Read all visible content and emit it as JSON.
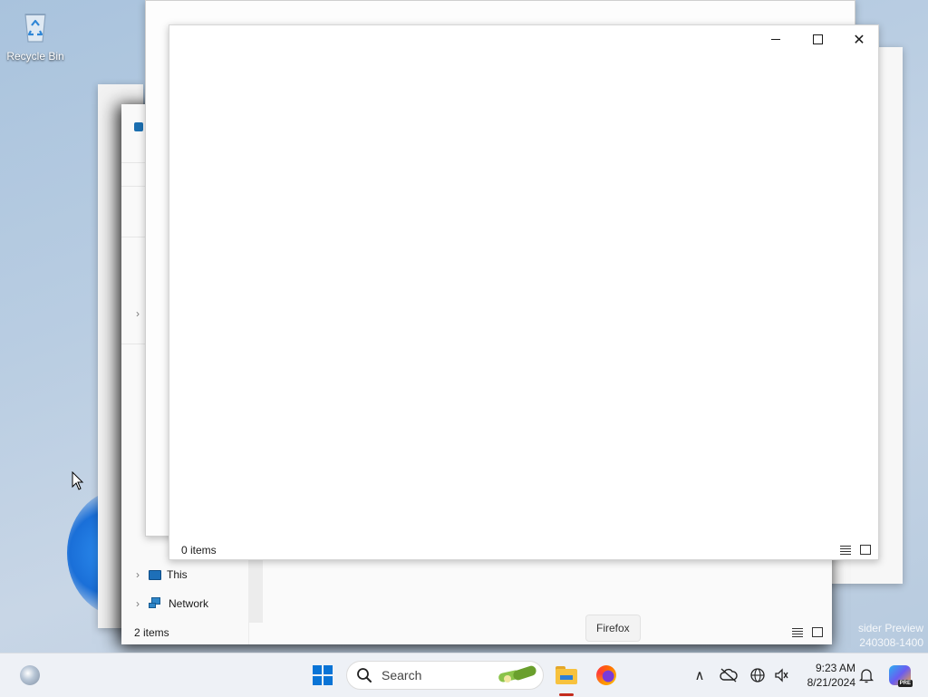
{
  "desktop": {
    "recycle_bin_label": "Recycle Bin",
    "watermark_line1": "sider Preview",
    "watermark_line2": "240308-1400"
  },
  "explorer_back": {
    "nav_items": [
      {
        "label": "This",
        "icon": "this-pc-icon"
      },
      {
        "label": "Network",
        "icon": "network-icon"
      }
    ],
    "status": "2 items"
  },
  "explorer_front": {
    "status": "0 items",
    "caption": {
      "minimize": "—",
      "maximize": "☐",
      "close": "✕"
    }
  },
  "tooltip": {
    "text": "Firefox"
  },
  "taskbar": {
    "search_placeholder": "Search",
    "clock_time": "9:23 AM",
    "clock_date": "8/21/2024",
    "pinned": [
      "windows-start",
      "file-explorer",
      "firefox"
    ],
    "active_app_indicator_color": "#c42b1c"
  },
  "colors": {
    "accent": "#0a74d6"
  }
}
